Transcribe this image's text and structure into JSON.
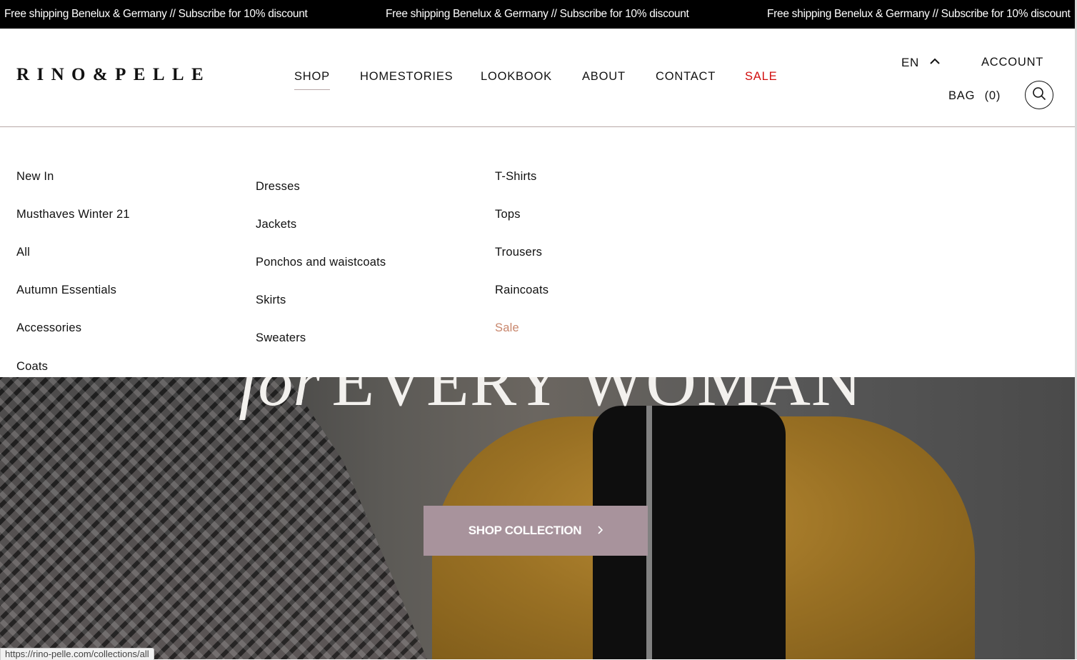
{
  "announcement": {
    "text": "Free shipping Benelux & Germany // Subscribe for 10% discount"
  },
  "header": {
    "logo": "RINO&PELLE",
    "nav": [
      {
        "label": "SHOP",
        "active": true
      },
      {
        "label": "HOMESTORIES"
      },
      {
        "label": "LOOKBOOK"
      },
      {
        "label": "ABOUT"
      },
      {
        "label": "CONTACT"
      },
      {
        "label": "SALE",
        "color": "#d10d0d"
      }
    ],
    "language": "EN",
    "account": "ACCOUNT",
    "bag_label": "BAG",
    "bag_count": "(0)"
  },
  "menu": {
    "col1": [
      "New In",
      "Musthaves Winter 21",
      "All",
      "Autumn Essentials",
      "Accessories",
      "Coats"
    ],
    "col2": [
      "Dresses",
      "Jackets",
      "Ponchos and waistcoats",
      "Skirts",
      "Sweaters"
    ],
    "col3": [
      "T-Shirts",
      "Tops",
      "Trousers",
      "Raincoats",
      "Sale"
    ]
  },
  "hero": {
    "title_italic": "for",
    "title_main": "EVERY WOMAN",
    "cta_label": "SHOP COLLECTION"
  },
  "status_bar": {
    "url": "https://rino-pelle.com/collections/all"
  },
  "colors": {
    "accent_sale": "#d10d0d",
    "menu_sale": "#c8866c",
    "cta_bg": "#a8939c"
  }
}
